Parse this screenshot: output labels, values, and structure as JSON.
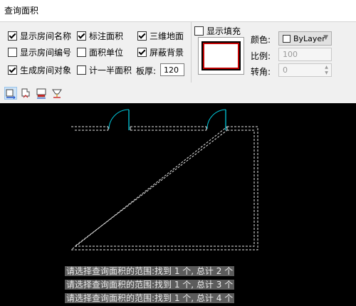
{
  "dialog": {
    "title": "查询面积",
    "options": [
      {
        "label": "显示房间名称",
        "checked": true
      },
      {
        "label": "标注面积",
        "checked": true
      },
      {
        "label": "三维地面",
        "checked": true
      },
      {
        "label": "显示房间编号",
        "checked": false
      },
      {
        "label": "面积单位",
        "checked": false
      },
      {
        "label": "屏蔽背景",
        "checked": true
      },
      {
        "label": "生成房间对象",
        "checked": true
      },
      {
        "label": "计一半面积",
        "checked": false
      }
    ],
    "thickness": {
      "label": "板厚:",
      "value": "120"
    },
    "fill": {
      "label": "显示填充",
      "checked": false
    },
    "color": {
      "label": "颜色:",
      "value": "ByLayer"
    },
    "scale": {
      "label": "比例:",
      "value": "100"
    },
    "rotation": {
      "label": "转角:",
      "value": "0"
    },
    "toolbar_icons": [
      "room-area-icon",
      "polygon-area-icon",
      "balcony-area-icon",
      "floor-area-icon"
    ]
  },
  "command_history": [
    "请选择查询面积的范围:找到 1 个, 总计 2 个",
    "请选择查询面积的范围:找到 1 个, 总计 3 个",
    "请选择查询面积的范围:找到 1 个, 总计 4 个"
  ],
  "colors": {
    "canvas": "#000000",
    "door_arc": "#00c8dc",
    "room_outline": "#e6e6e6",
    "command_bg": "#5c5c5c"
  }
}
